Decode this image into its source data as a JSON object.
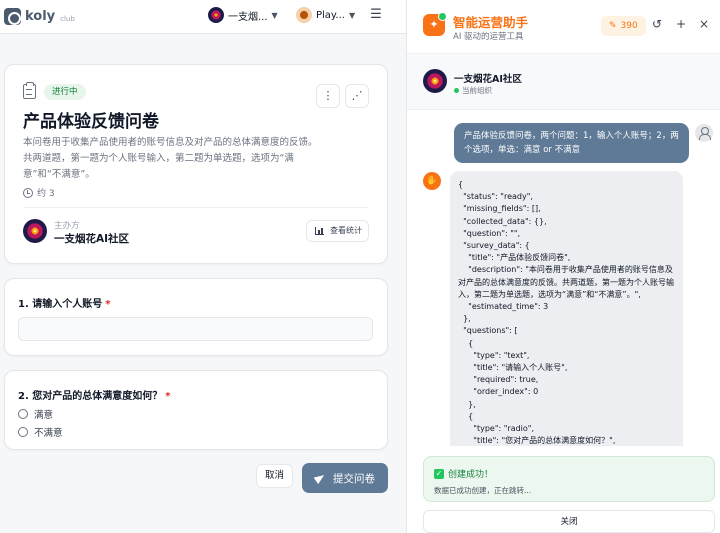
{
  "topbar": {
    "logo_text": "koly",
    "logo_sub": "club",
    "workspace_label": "一支烟...",
    "player_label": "Play...",
    "menu_glyph": "☰"
  },
  "survey": {
    "status": "进行中",
    "title": "产品体验反馈问卷",
    "description": "本问卷用于收集产品使用者的账号信息及对产品的总体满意度的反馈。共两道题，第一题为个人账号输入，第二题为单选题，选项为“满意”和“不满意”。",
    "estimated_time": "约 3",
    "organizer_label": "主办方",
    "organizer_name": "一支烟花AI社区",
    "stats_button": "查看统计",
    "more_glyph": "⋮",
    "share_glyph": "⋰"
  },
  "questions": [
    {
      "title": "1. 请输入个人账号",
      "required_mark": "*",
      "value": ""
    },
    {
      "title": "2. 您对产品的总体满意度如何？",
      "required_mark": "*",
      "options": [
        "满意",
        "不满意"
      ]
    }
  ],
  "actions": {
    "cancel": "取消",
    "submit": "提交问卷"
  },
  "assistant": {
    "title": "智能运营助手",
    "subtitle": "AI 驱动的运营工具",
    "credits": "390",
    "credit_icon": "✎",
    "history_glyph": "↺",
    "new_glyph": "+",
    "close_glyph": "×",
    "org_name": "一支烟花AI社区",
    "org_sub": "当前组织",
    "user_message": "产品体验反馈问卷，两个问题：1，输入个人账号；2，两个选项，单选：满意 or 不满意",
    "bot_code": "{\n  \"status\": \"ready\",\n  \"missing_fields\": [],\n  \"collected_data\": {},\n  \"question\": \"\",\n  \"survey_data\": {\n    \"title\": \"产品体验反馈问卷\",\n    \"description\": \"本问卷用于收集产品使用者的账号信息及对产品的总体满意度的反馈。共两道题，第一题为个人账号输入，第二题为单选题，选项为“满意”和“不满意”。\",\n    \"estimated_time\": 3\n  },\n  \"questions\": [\n    {\n      \"type\": \"text\",\n      \"title\": \"请输入个人账号\",\n      \"required\": true,\n      \"order_index\": 0\n    },\n    {\n      \"type\": \"radio\",\n      \"title\": \"您对产品的总体满意度如何？\",",
    "success_title": "创建成功！",
    "success_sub": "数据已成功创建，正在跳转...",
    "close_label": "关闭"
  },
  "colors": {
    "accent": "#f97316",
    "primary_button": "#5f7a96",
    "status_green": "#15803d"
  }
}
